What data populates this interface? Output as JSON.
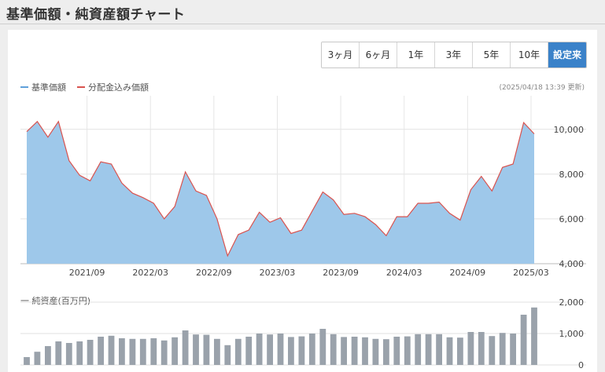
{
  "page": {
    "title": "基準価額・純資産額チャート",
    "updated": "(2025/04/18 13:39 更新)"
  },
  "buttons": [
    {
      "label": "3ヶ月",
      "active": false
    },
    {
      "label": "6ヶ月",
      "active": false
    },
    {
      "label": "1年",
      "active": false
    },
    {
      "label": "3年",
      "active": false
    },
    {
      "label": "5年",
      "active": false
    },
    {
      "label": "10年",
      "active": false
    },
    {
      "label": "設定来",
      "active": true
    }
  ],
  "legend": {
    "nav_label": "基準価額",
    "nav_color": "#5fa0da",
    "reinvested_label": "分配金込み価額",
    "reinvested_color": "#d9534f"
  },
  "volume_label": "一 純資産(百万円)",
  "chart_data": [
    {
      "type": "area",
      "series": [
        {
          "name": "基準価額",
          "color": "#9ec8ea",
          "values": [
            9900,
            10350,
            9650,
            10350,
            8600,
            7950,
            7700,
            8550,
            8450,
            7600,
            7150,
            6950,
            6700,
            6000,
            6550,
            8100,
            7250,
            7050,
            6000,
            4350,
            5300,
            5500,
            6300,
            5850,
            6050,
            5350,
            5500,
            6350,
            7200,
            6850,
            6200,
            6250,
            6100,
            5750,
            5250,
            6100,
            6100,
            6700,
            6700,
            6750,
            6250,
            5950,
            7300,
            7900,
            7250,
            8300,
            8450,
            10300,
            9800
          ]
        },
        {
          "name": "分配金込み価額",
          "color": "#d9534f",
          "values": [
            9900,
            10350,
            9650,
            10350,
            8600,
            7950,
            7700,
            8550,
            8450,
            7600,
            7150,
            6950,
            6700,
            6000,
            6550,
            8100,
            7250,
            7050,
            6000,
            4350,
            5300,
            5500,
            6300,
            5850,
            6050,
            5350,
            5500,
            6350,
            7200,
            6850,
            6200,
            6250,
            6100,
            5750,
            5250,
            6100,
            6100,
            6700,
            6700,
            6750,
            6250,
            5950,
            7300,
            7900,
            7250,
            8300,
            8450,
            10300,
            9800
          ]
        }
      ],
      "xticks": [
        "2021/09",
        "2022/03",
        "2022/09",
        "2023/03",
        "2023/09",
        "2024/03",
        "2024/09",
        "2025/03"
      ],
      "xtick_index": [
        5.7,
        11.7,
        17.7,
        23.7,
        29.7,
        35.7,
        41.7,
        47.7
      ],
      "yticks": [
        "4,000",
        "6,000",
        "8,000",
        "10,000"
      ],
      "ytick_values": [
        4000,
        6000,
        8000,
        10000
      ],
      "ylim": [
        4000,
        11500
      ]
    },
    {
      "type": "bar",
      "series": [
        {
          "name": "純資産",
          "color": "#9aa2ab",
          "values": [
            250,
            420,
            600,
            750,
            700,
            750,
            800,
            900,
            930,
            850,
            830,
            830,
            850,
            780,
            880,
            1100,
            970,
            960,
            830,
            630,
            830,
            900,
            1000,
            970,
            1000,
            890,
            910,
            1000,
            1150,
            980,
            890,
            900,
            880,
            830,
            820,
            900,
            910,
            980,
            980,
            980,
            880,
            870,
            1050,
            1050,
            920,
            1020,
            1000,
            1600,
            1830
          ]
        }
      ],
      "yticks": [
        "0",
        "1,000",
        "2,000"
      ],
      "ytick_values": [
        0,
        1000,
        2000
      ],
      "ylim": [
        0,
        2000
      ]
    }
  ]
}
